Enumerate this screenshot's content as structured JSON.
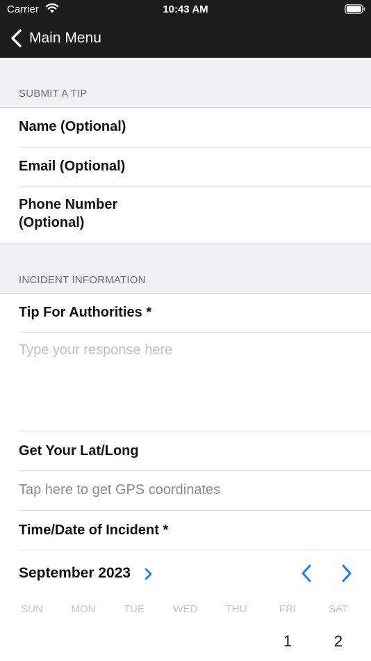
{
  "status_bar": {
    "carrier": "Carrier",
    "time": "10:43 AM"
  },
  "nav": {
    "back_label": "Main Menu"
  },
  "sections": {
    "tip": {
      "header": "SUBMIT A TIP",
      "name_label": "Name (Optional)",
      "email_label": "Email (Optional)",
      "phone_label_line1": "Phone Number",
      "phone_label_line2": "(Optional)"
    },
    "incident": {
      "header": "INCIDENT INFORMATION",
      "tip_label": "Tip For Authorities *",
      "tip_placeholder": "Type your response here",
      "latlong_label": "Get Your Lat/Long",
      "gps_link": "Tap here to get GPS coordinates",
      "datetime_label": "Time/Date of Incident *"
    }
  },
  "calendar": {
    "month": "September 2023",
    "weekdays": [
      "SUN",
      "MON",
      "TUE",
      "WED",
      "THU",
      "FRI",
      "SAT"
    ],
    "days": [
      "1",
      "2"
    ],
    "accent": "#1a7ff5"
  }
}
